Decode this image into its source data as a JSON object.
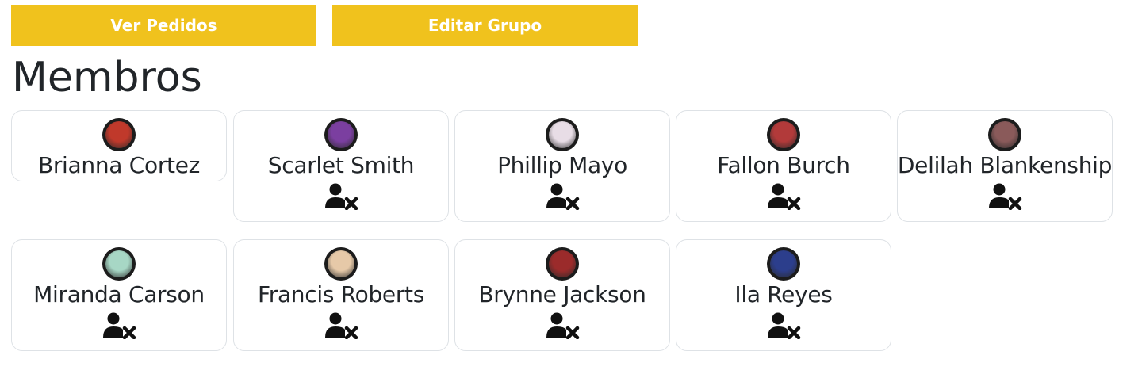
{
  "actions": {
    "view_orders_label": "Ver Pedidos",
    "edit_group_label": "Editar Grupo"
  },
  "section_title": "Membros",
  "colors": {
    "accent": "#f0c21d",
    "card_border": "#dee2e6",
    "text": "#212529"
  },
  "members": [
    {
      "name": "Brianna Cortez",
      "avatar_icon": "member-avatar",
      "avatar_color": "#c0392b",
      "removable": false
    },
    {
      "name": "Scarlet Smith",
      "avatar_icon": "member-avatar",
      "avatar_color": "#7b3fa0",
      "removable": true
    },
    {
      "name": "Phillip Mayo",
      "avatar_icon": "member-avatar",
      "avatar_color": "#e8dde6",
      "removable": true
    },
    {
      "name": "Fallon Burch",
      "avatar_icon": "member-avatar",
      "avatar_color": "#b23a3a",
      "removable": true
    },
    {
      "name": "Delilah Blankenship",
      "avatar_icon": "member-avatar",
      "avatar_color": "#8a5a5a",
      "removable": true
    },
    {
      "name": "Miranda Carson",
      "avatar_icon": "member-avatar",
      "avatar_color": "#a7d7c5",
      "removable": true
    },
    {
      "name": "Francis Roberts",
      "avatar_icon": "member-avatar",
      "avatar_color": "#e6c9a8",
      "removable": true
    },
    {
      "name": "Brynne Jackson",
      "avatar_icon": "member-avatar",
      "avatar_color": "#9b2b2b",
      "removable": true
    },
    {
      "name": "Ila Reyes",
      "avatar_icon": "member-avatar",
      "avatar_color": "#2c3e8c",
      "removable": true
    }
  ],
  "remove_icon": "user-remove-icon"
}
